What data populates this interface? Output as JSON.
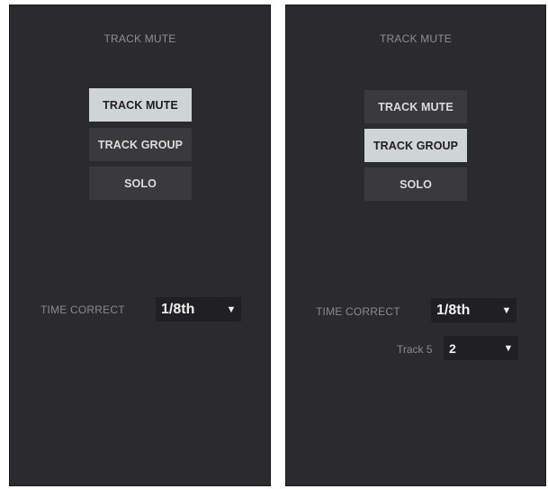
{
  "left_panel": {
    "title": "TRACK MUTE",
    "buttons": [
      {
        "label": "TRACK MUTE",
        "active": true
      },
      {
        "label": "TRACK GROUP",
        "active": false
      },
      {
        "label": "SOLO",
        "active": false
      }
    ],
    "time_correct_label": "TIME CORRECT",
    "time_correct_value": "1/8th",
    "caret_icon": "▼"
  },
  "right_panel": {
    "title": "TRACK MUTE",
    "buttons": [
      {
        "label": "TRACK MUTE",
        "active": false
      },
      {
        "label": "TRACK GROUP",
        "active": true
      },
      {
        "label": "SOLO",
        "active": false
      }
    ],
    "time_correct_label": "TIME CORRECT",
    "time_correct_value": "1/8th",
    "track_label": "Track 5",
    "track_value": "2",
    "caret_icon": "▼"
  },
  "colors": {
    "panel_bg": "#2b2b2d",
    "button_bg": "#3a3a3c",
    "button_active_bg": "#cfd4d5",
    "select_bg": "#202022"
  }
}
